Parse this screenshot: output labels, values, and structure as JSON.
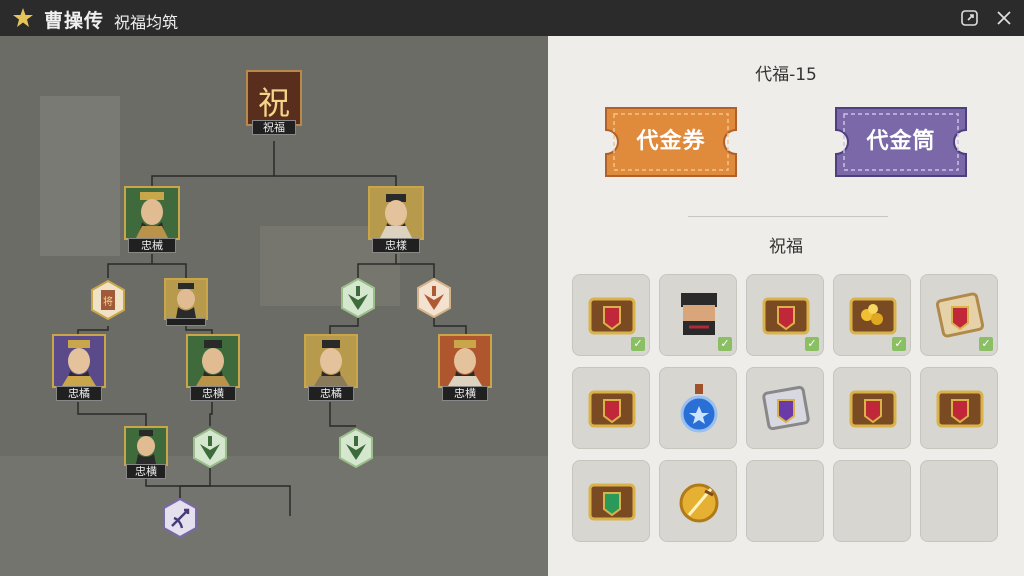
{
  "titlebar": {
    "title": "曹操传",
    "subtitle": "祝福均筑"
  },
  "tree": {
    "root_glyph": "祝",
    "root_label": "祝福",
    "level1": [
      {
        "label": "忠械"
      },
      {
        "label": "忠樣"
      }
    ],
    "level2_portrait_label": "",
    "level3": [
      {
        "label": "忠橘"
      },
      {
        "label": "忠横"
      },
      {
        "label": "忠橘"
      },
      {
        "label": "忠横"
      }
    ],
    "level4": [
      {
        "label": "忠横"
      }
    ]
  },
  "panel": {
    "cost_label": "代福-15",
    "ticket_orange": "代金券",
    "ticket_purple": "代金筒",
    "blessing_heading": "祝福",
    "slots": [
      {
        "icon": "red-chest-icon",
        "checked": true
      },
      {
        "icon": "warrior-head-icon",
        "checked": true
      },
      {
        "icon": "red-chest-icon",
        "checked": true
      },
      {
        "icon": "gold-chest-icon",
        "checked": true
      },
      {
        "icon": "scroll-chest-icon",
        "checked": true
      },
      {
        "icon": "red-chest-icon",
        "checked": false
      },
      {
        "icon": "blue-potion-icon",
        "checked": false
      },
      {
        "icon": "purple-scroll-icon",
        "checked": false
      },
      {
        "icon": "red-chest-icon",
        "checked": false
      },
      {
        "icon": "red-chest-icon",
        "checked": false
      },
      {
        "icon": "green-chest-icon",
        "checked": false
      },
      {
        "icon": "gold-sword-icon",
        "checked": false
      },
      {
        "icon": "empty-slot",
        "checked": false
      },
      {
        "icon": "empty-slot",
        "checked": false
      },
      {
        "icon": "empty-slot",
        "checked": false
      }
    ]
  },
  "colors": {
    "orange": "#e08a3c",
    "purple": "#7a68a8",
    "gold": "#c9a64a",
    "check": "#8bbf63"
  }
}
